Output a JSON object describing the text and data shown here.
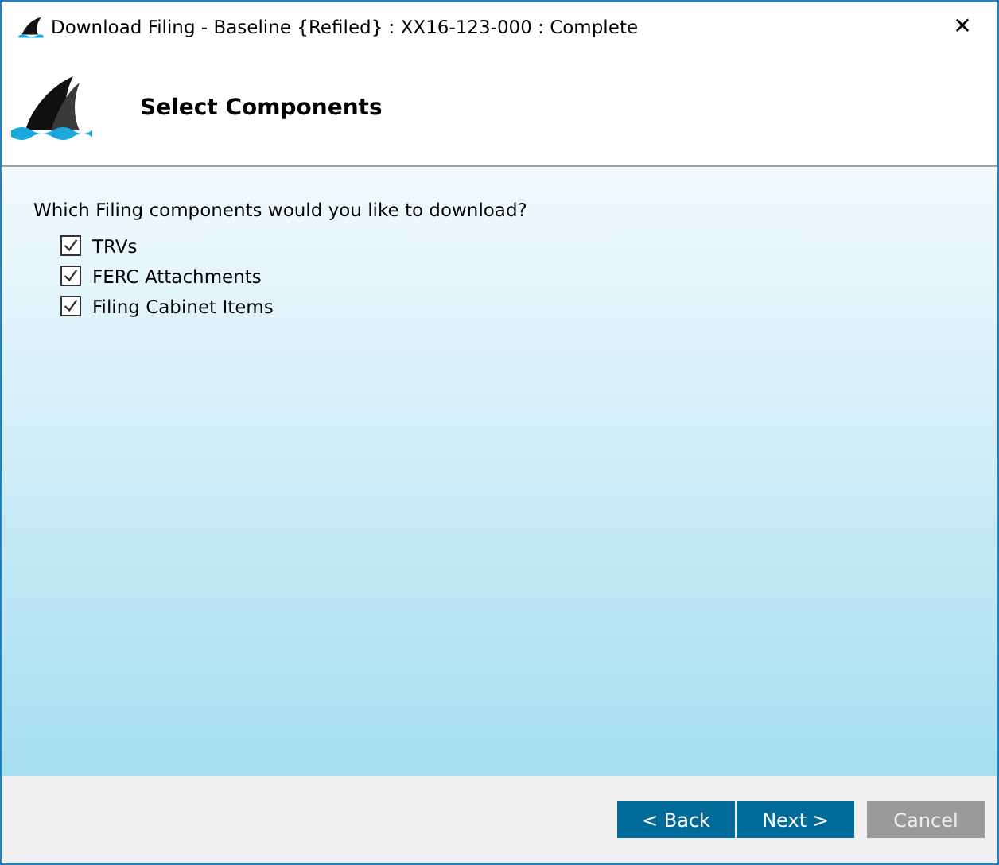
{
  "window": {
    "title": "Download Filing - Baseline {Refiled} : XX16-123-000 : Complete",
    "close": "✕"
  },
  "header": {
    "title": "Select Components"
  },
  "question": "Which Filing components would you like to download?",
  "components": [
    {
      "label": "TRVs",
      "checked": true
    },
    {
      "label": "FERC Attachments",
      "checked": true
    },
    {
      "label": "Filing Cabinet Items",
      "checked": true
    }
  ],
  "buttons": [
    {
      "label": "< Back",
      "disabled": false
    },
    {
      "label": "Next >",
      "disabled": false
    },
    {
      "label": "Cancel",
      "disabled": true
    }
  ]
}
